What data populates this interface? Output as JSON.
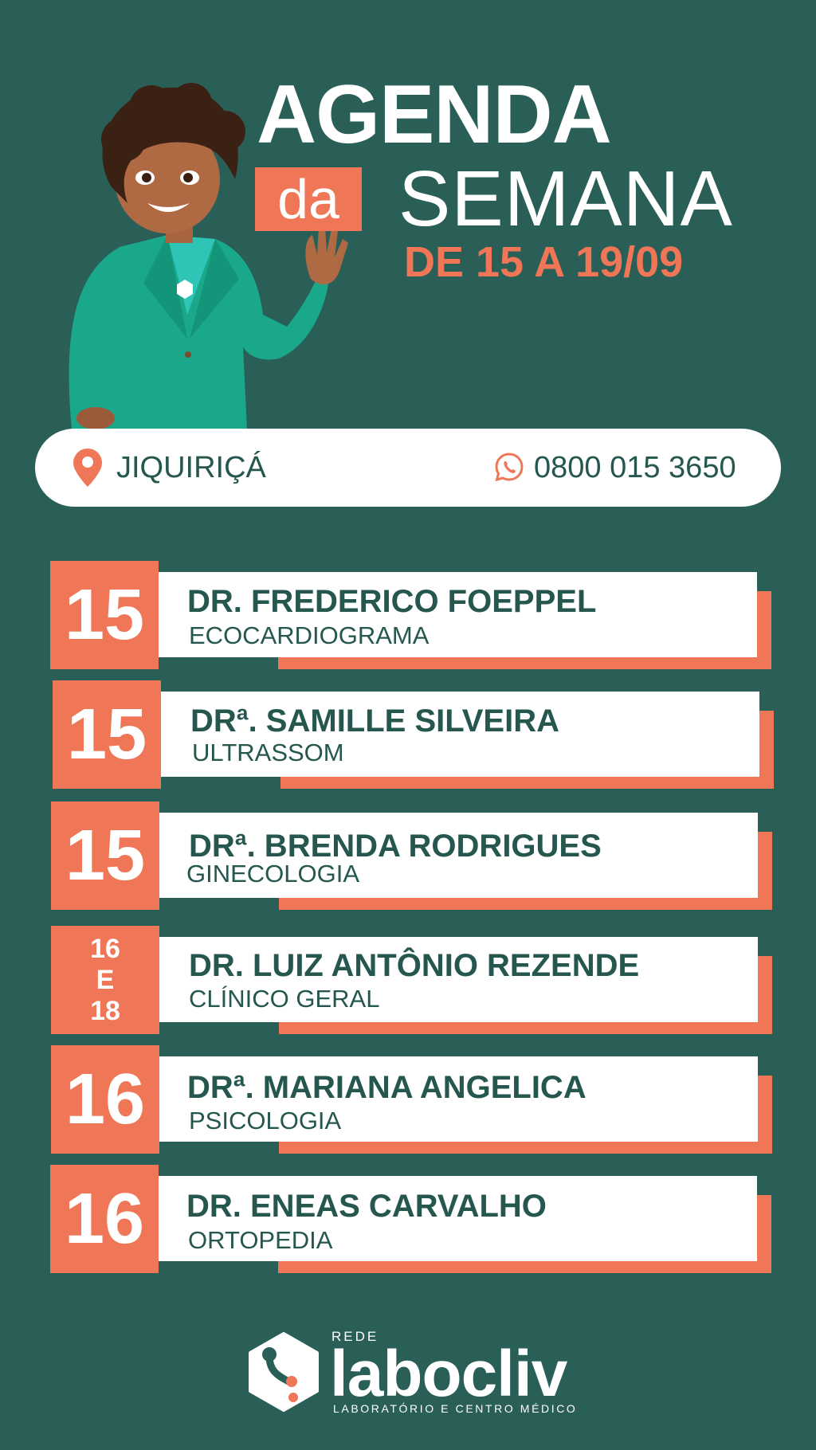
{
  "header": {
    "title_line1": "AGENDA",
    "title_da": "da",
    "title_line2": "SEMANA",
    "date_range": "DE 15 A 19/09"
  },
  "info_bar": {
    "location_icon": "map-pin-icon",
    "city": "JIQUIRIÇÁ",
    "phone_icon": "whatsapp-icon",
    "phone": "0800 015 3650"
  },
  "schedule": [
    {
      "day": "15",
      "doctor": "DR. FREDERICO FOEPPEL",
      "specialty": "ECOCARDIOGRAMA"
    },
    {
      "day": "15",
      "doctor": "DRª. SAMILLE SILVEIRA",
      "specialty": "ULTRASSOM"
    },
    {
      "day": "15",
      "doctor": "DRª. BRENDA RODRIGUES",
      "specialty": "GINECOLOGIA"
    },
    {
      "day_lines": [
        "16",
        "E",
        "18"
      ],
      "doctor": "DR. LUIZ ANTÔNIO REZENDE",
      "specialty": "CLÍNICO GERAL"
    },
    {
      "day": "16",
      "doctor": "DRª. MARIANA ANGELICA",
      "specialty": "PSICOLOGIA"
    },
    {
      "day": "16",
      "doctor": "DR. ENEAS CARVALHO",
      "specialty": "ORTOPEDIA"
    }
  ],
  "logo": {
    "prefix": "REDE",
    "name": "labocliv",
    "tagline": "LABORATÓRIO E CENTRO MÉDICO"
  },
  "colors": {
    "background": "#2a5f57",
    "accent": "#ef7657",
    "text_dark": "#25574f",
    "white": "#ffffff"
  }
}
